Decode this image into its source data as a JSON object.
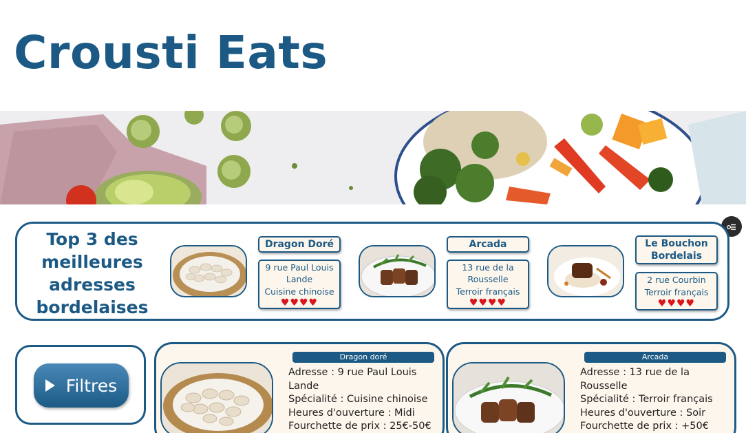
{
  "site": {
    "title": "Crousti Eats"
  },
  "top3": {
    "title": "Top 3 des meilleures adresses bordelaises",
    "items": [
      {
        "name": "Dragon Doré",
        "address": "9 rue Paul Louis Lande",
        "cuisine": "Cuisine chinoise",
        "hearts": "♥♥♥♥",
        "rating": 4
      },
      {
        "name": "Arcada",
        "address": "13 rue de la Rousselle",
        "cuisine": "Terroir français",
        "hearts": "♥♥♥♥",
        "rating": 4
      },
      {
        "name": "Le Bouchon Bordelais",
        "address": "2 rue Courbin",
        "cuisine": "Terroir français",
        "hearts": "♥♥♥♥",
        "rating": 4
      }
    ]
  },
  "filters": {
    "label": "Filtres"
  },
  "restaurants": [
    {
      "name": "Dragon doré",
      "address": "Adresse : 9 rue Paul Louis Lande",
      "specialty": "Spécialité : Cuisine chinoise",
      "hours": "Heures d'ouverture : Midi",
      "price": "Fourchette de prix : 25€-50€"
    },
    {
      "name": "Arcada",
      "address": "Adresse : 13 rue de la Rousselle",
      "specialty": "Spécialité : Terroir français",
      "hours": "Heures d'ouverture : Soir",
      "price": "Fourchette de prix : +50€"
    }
  ],
  "colors": {
    "brand": "#1c5a85",
    "card_bg": "#fdf6ec",
    "heart": "#d8161b"
  },
  "icons": {
    "filters": "play-triangle-icon",
    "settings": "settings-sliders-icon"
  }
}
